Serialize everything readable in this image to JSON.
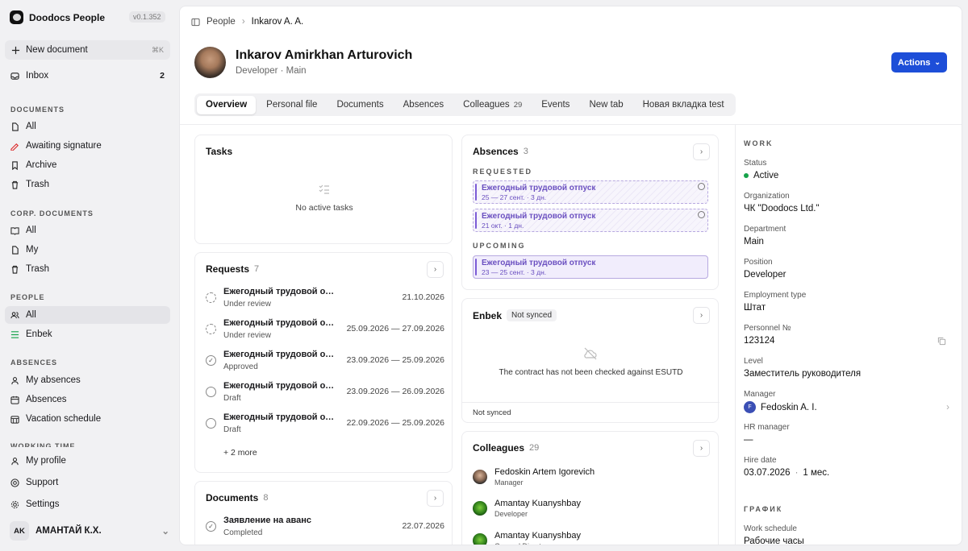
{
  "app": {
    "name": "Doodocs People",
    "version": "v0.1.352"
  },
  "sidebar": {
    "new_document": "New document",
    "new_document_kbd": "⌘K",
    "inbox": {
      "label": "Inbox",
      "count": "2"
    },
    "sections": {
      "documents": "DOCUMENTS",
      "corp": "CORP. DOCUMENTS",
      "people": "PEOPLE",
      "absences": "ABSENCES",
      "working_time": "WORKING TIME"
    },
    "documents": [
      "All",
      "Awaiting signature",
      "Archive",
      "Trash"
    ],
    "corp": [
      "All",
      "My",
      "Trash"
    ],
    "people": [
      "All",
      "Enbek"
    ],
    "absences": [
      "My absences",
      "Absences",
      "Vacation schedule"
    ],
    "bottom": [
      "My profile",
      "Support",
      "Settings"
    ],
    "user": {
      "initials": "AK",
      "name": "АМАНТАЙ К.Х."
    }
  },
  "breadcrumb": {
    "parent": "People",
    "current": "Inkarov A. A."
  },
  "profile": {
    "name": "Inkarov Amirkhan Arturovich",
    "subtitle": "Developer · Main",
    "actions_label": "Actions"
  },
  "tabs": [
    {
      "label": "Overview"
    },
    {
      "label": "Personal file"
    },
    {
      "label": "Documents"
    },
    {
      "label": "Absences"
    },
    {
      "label": "Colleagues",
      "count": "29"
    },
    {
      "label": "Events"
    },
    {
      "label": "New tab"
    },
    {
      "label": "Новая вкладка test"
    }
  ],
  "tasks": {
    "title": "Tasks",
    "empty": "No active tasks"
  },
  "requests": {
    "title": "Requests",
    "count": "7",
    "more": "+ 2 more",
    "items": [
      {
        "title": "Ежегодный трудовой отпуск",
        "status": "Under review",
        "date": "21.10.2026"
      },
      {
        "title": "Ежегодный трудовой отпуск",
        "status": "Under review",
        "date": "25.09.2026 — 27.09.2026"
      },
      {
        "title": "Ежегодный трудовой отпуск",
        "status": "Approved",
        "date": "23.09.2026 — 25.09.2026"
      },
      {
        "title": "Ежегодный трудовой отпуск",
        "status": "Draft",
        "date": "23.09.2026 — 26.09.2026"
      },
      {
        "title": "Ежегодный трудовой отпуск",
        "status": "Draft",
        "date": "22.09.2026 — 25.09.2026"
      }
    ]
  },
  "documents_card": {
    "title": "Documents",
    "count": "8",
    "items": [
      {
        "title": "Заявление на аванс",
        "status": "Completed",
        "date": "22.07.2026"
      }
    ]
  },
  "absences": {
    "title": "Absences",
    "count": "3",
    "requested_label": "REQUESTED",
    "upcoming_label": "UPCOMING",
    "requested": [
      {
        "title": "Ежегодный трудовой отпуск",
        "sub": "25 — 27 сент. · 3 дн."
      },
      {
        "title": "Ежегодный трудовой отпуск",
        "sub": "21 окт. · 1 дн."
      }
    ],
    "upcoming": [
      {
        "title": "Ежегодный трудовой отпуск",
        "sub": "23 — 25 сент. · 3 дн."
      }
    ]
  },
  "enbek": {
    "title": "Enbek",
    "badge": "Not synced",
    "message": "The contract has not been checked against ESUTD",
    "footer": "Not synced"
  },
  "colleagues": {
    "title": "Colleagues",
    "count": "29",
    "items": [
      {
        "name": "Fedoskin Artem Igorevich",
        "role": "Manager"
      },
      {
        "name": "Amantay Kuanyshbay",
        "role": "Developer"
      },
      {
        "name": "Amantay Kuanyshbay",
        "role": "General Director"
      }
    ]
  },
  "work": {
    "section": "WORK",
    "status_label": "Status",
    "status": "Active",
    "org_label": "Organization",
    "org": "ЧК \"Doodocs Ltd.\"",
    "dept_label": "Department",
    "dept": "Main",
    "position_label": "Position",
    "position": "Developer",
    "emp_label": "Employment type",
    "emp": "Штат",
    "personnel_label": "Personnel №",
    "personnel": "123124",
    "level_label": "Level",
    "level": "Заместитель руководителя",
    "manager_label": "Manager",
    "manager": "Fedoskin A. I.",
    "manager_initial": "F",
    "hr_label": "HR manager",
    "hr": "—",
    "hire_label": "Hire date",
    "hire": "03.07.2026",
    "hire_dur": "1 мес."
  },
  "schedule": {
    "section": "ГРАФИК",
    "label": "Work schedule",
    "value": "Рабочие часы"
  },
  "colors": {
    "accent": "#1d4ed8",
    "absence": "#7c5cd6",
    "active": "#16a34a"
  }
}
